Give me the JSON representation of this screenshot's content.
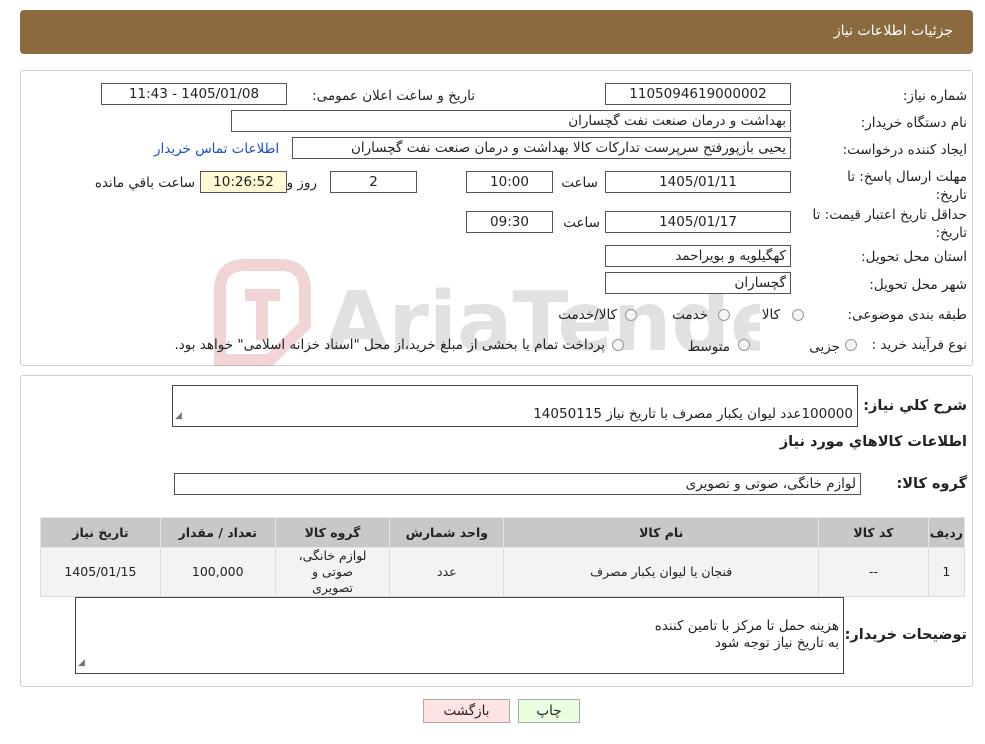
{
  "header": {
    "title": "جزئیات اطلاعات نیاز"
  },
  "info": {
    "need_number_label": "شماره نیاز:",
    "need_number": "1105094619000002",
    "announce_label": "تاریخ و ساعت اعلان عمومی:",
    "announce_value": "1405/01/08 - 11:43",
    "buyer_org_label": "نام دستگاه خریدار:",
    "buyer_org": "بهداشت و درمان صنعت نفت گچساران",
    "creator_label": "ایجاد کننده درخواست:",
    "creator": "یحیی بازپورفتح سرپرست تدارکات کالا  بهداشت و درمان صنعت نفت گچساران",
    "contact_link": "اطلاعات تماس خریدار",
    "deadline_label": "مهلت ارسال پاسخ: تا تاریخ:",
    "deadline_date": "1405/01/11",
    "time_label": "ساعت",
    "deadline_time": "10:00",
    "days_value": "2",
    "days_label": "روز و",
    "remaining_time": "10:26:52",
    "remaining_label": "ساعت باقي مانده",
    "validity_label": "حداقل تاریخ اعتبار قیمت: تا تاریخ:",
    "validity_date": "1405/01/17",
    "validity_time_label": "ساعت",
    "validity_time": "09:30",
    "province_label": "استان محل تحویل:",
    "province": "کهگیلویه و بویراحمد",
    "city_label": "شهر محل تحویل:",
    "city": "گچساران",
    "category_label": "طبقه بندی موضوعی:",
    "category_options": [
      "کالا",
      "خدمت",
      "کالا/خدمت"
    ],
    "process_label": "نوع فرآیند خرید :",
    "process_options": [
      "جزیی",
      "متوسط"
    ],
    "process_note": "پرداخت تمام یا بخشی از مبلغ خرید،از محل \"اسناد خزانه اسلامی\" خواهد بود."
  },
  "details": {
    "summary_label": "شرح کلي نياز:",
    "summary": "100000عدد لیوان یکبار مصرف با تاریخ نیاز 14050115",
    "goods_info_heading": "اطلاعات کالاهاي مورد نياز",
    "goods_group_label": "گروه کالا:",
    "goods_group": "لوازم خانگی، صوتی و تصویری",
    "table": {
      "headers": [
        "رديف",
        "کد کالا",
        "نام کالا",
        "واحد شمارش",
        "گروه کالا",
        "تعداد / مقدار",
        "تاریخ نیاز"
      ],
      "rows": [
        [
          "1",
          "--",
          "فنجان یا لیوان یکبار مصرف",
          "عدد",
          "لوازم خانگی، صوتی و تصویری",
          "100,000",
          "1405/01/15"
        ]
      ]
    },
    "buyer_notes_label": "توضیحات خریدار:",
    "buyer_notes": "هزینه حمل تا مرکز با تامین کننده\nبه تاریخ نیاز توجه شود"
  },
  "buttons": {
    "print": "چاپ",
    "back": "بازگشت"
  },
  "colors": {
    "title_bar": "#8b6a3e",
    "print_button": "#eaffe0",
    "back_button": "#ffe3e3",
    "link": "#1a4fd1"
  }
}
